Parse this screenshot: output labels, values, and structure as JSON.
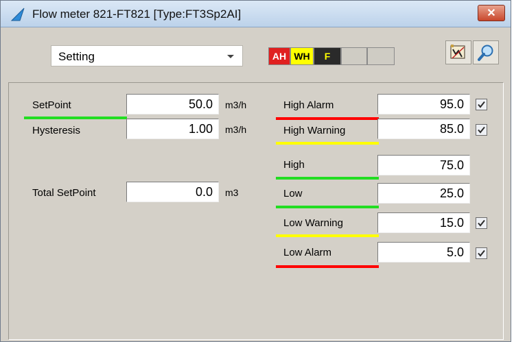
{
  "window": {
    "title": "Flow meter 821-FT821  [Type:FT3Sp2AI]",
    "close_label": "✕"
  },
  "toolbar": {
    "mode_select": "Setting",
    "status": {
      "ah": "AH",
      "wh": "WH",
      "f": "F"
    }
  },
  "left": {
    "setpoint": {
      "label": "SetPoint",
      "value": "50.0",
      "unit": "m3/h"
    },
    "hysteresis": {
      "label": "Hysteresis",
      "value": "1.00",
      "unit": "m3/h"
    },
    "total_setpoint": {
      "label": "Total SetPoint",
      "value": "0.0",
      "unit": "m3"
    }
  },
  "limits": [
    {
      "label": "High Alarm",
      "value": "95.0",
      "checked": true,
      "bar_color": "#ff0000"
    },
    {
      "label": "High Warning",
      "value": "85.0",
      "checked": true,
      "bar_color": "#ffff00"
    },
    {
      "label": "High",
      "value": "75.0",
      "checked": false,
      "bar_color": "#22dd22"
    },
    {
      "label": "Low",
      "value": "25.0",
      "checked": false,
      "bar_color": "#22dd22"
    },
    {
      "label": "Low Warning",
      "value": "15.0",
      "checked": true,
      "bar_color": "#ffff00"
    },
    {
      "label": "Low Alarm",
      "value": "5.0",
      "checked": true,
      "bar_color": "#ff0000"
    }
  ],
  "colors": {
    "setpoint_bar": "#22dd22",
    "status_ah_bg": "#e02020",
    "status_wh_bg": "#ffff00",
    "status_f_bg": "#2a2a2a"
  },
  "icons": [
    "app-icon",
    "close-icon",
    "dropdown-arrow-icon",
    "trend-icon",
    "magnifier-icon",
    "checkmark-icon"
  ]
}
